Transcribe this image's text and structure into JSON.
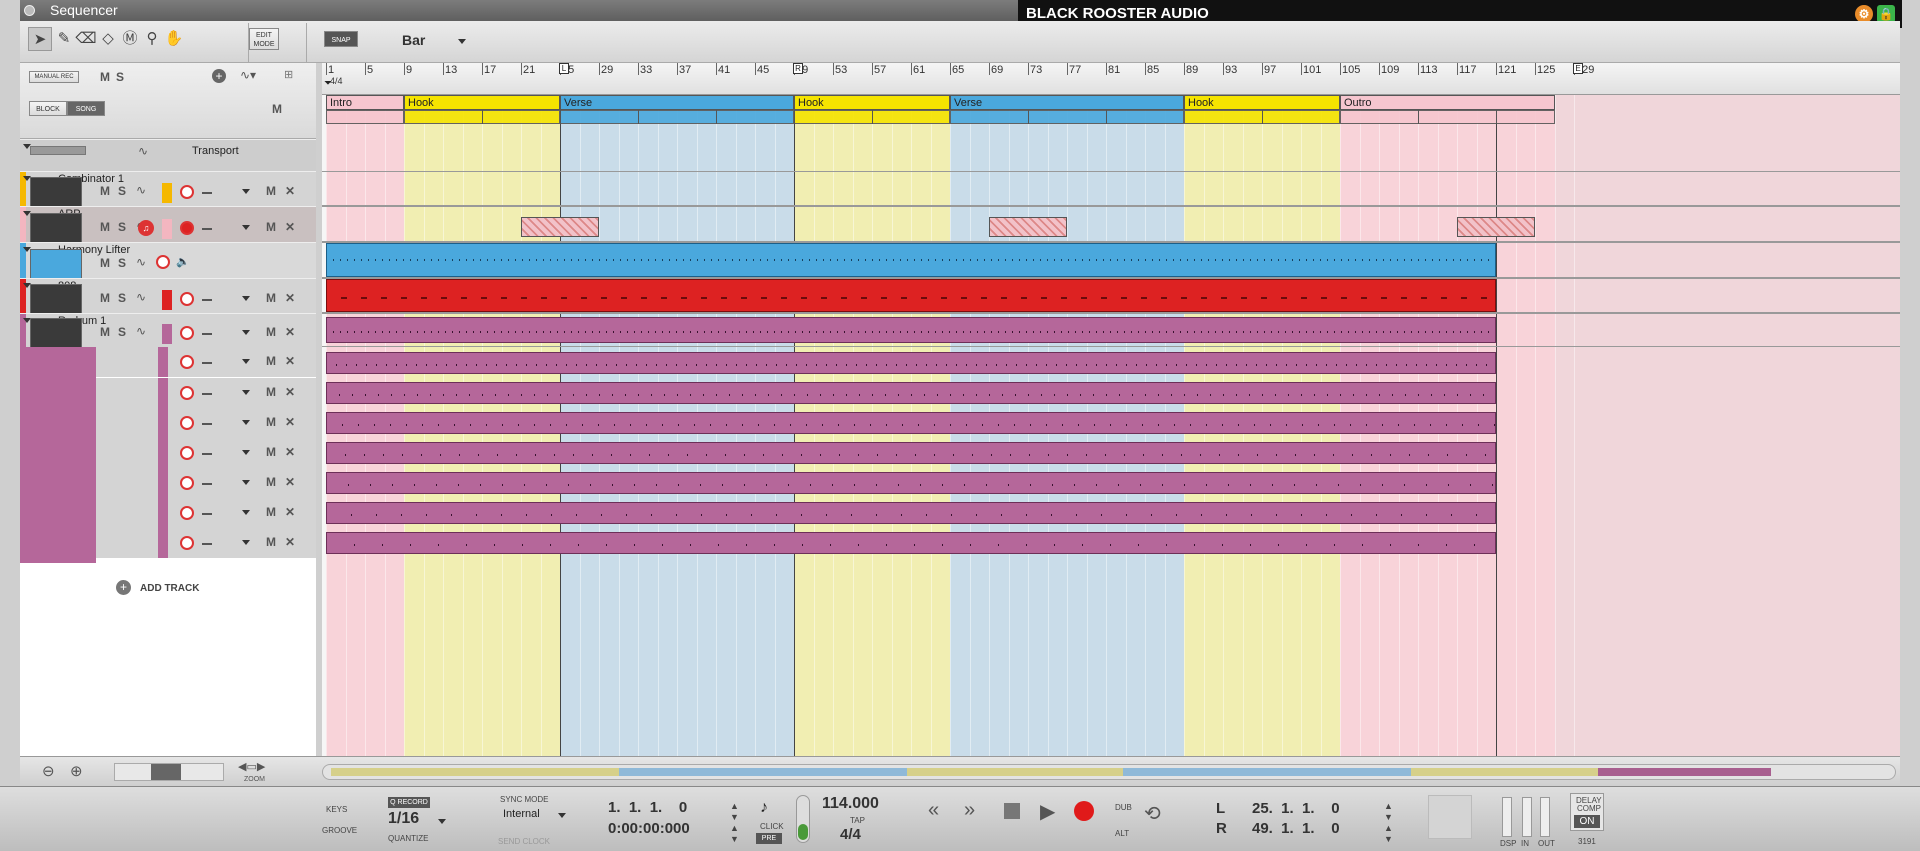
{
  "window": {
    "title": "Sequencer",
    "brand": "BLACK ROOSTER AUDIO"
  },
  "toolbar": {
    "edit_mode": [
      "EDIT",
      "MODE"
    ],
    "snap": "SNAP",
    "snap_value": "Bar"
  },
  "left_panel": {
    "manual_rec": "MANUAL REC",
    "m": "M",
    "s": "S",
    "block": "BLOCK",
    "song": "SONG",
    "transport_track": "Transport",
    "add_track": "ADD TRACK",
    "tracks": [
      {
        "name": "Combinator 1",
        "color": "#f5b800"
      },
      {
        "name": "ARP",
        "color": "#f3b6c0"
      },
      {
        "name": "Harmony Lifter",
        "color": "#4aa8dd"
      },
      {
        "name": "808",
        "color": "#dd2222"
      },
      {
        "name": "Redrum 1",
        "color": "#b5679a"
      }
    ],
    "lane_labels": {
      "m": "M",
      "s": "S",
      "x": "✕"
    }
  },
  "ruler": {
    "bars": [
      "1",
      "5",
      "9",
      "13",
      "17",
      "21",
      "25",
      "29",
      "33",
      "37",
      "41",
      "45",
      "49",
      "53",
      "57",
      "61",
      "65",
      "69",
      "73",
      "77",
      "81",
      "85",
      "89",
      "93",
      "97",
      "101",
      "105",
      "109",
      "113",
      "117",
      "121",
      "125",
      "129"
    ],
    "time_sig": "4/4",
    "markers": {
      "loop_left": "L",
      "loop_right": "R",
      "end": "E"
    }
  },
  "blocks": [
    {
      "label": "Intro",
      "start": 1,
      "end": 9,
      "color": "#f6c6cf"
    },
    {
      "label": "Hook",
      "start": 9,
      "end": 25,
      "color": "#f5e400"
    },
    {
      "label": "Verse",
      "start": 25,
      "end": 49,
      "color": "#4aa8dd"
    },
    {
      "label": "Hook",
      "start": 49,
      "end": 65,
      "color": "#f5e400"
    },
    {
      "label": "Verse",
      "start": 65,
      "end": 89,
      "color": "#4aa8dd"
    },
    {
      "label": "Hook",
      "start": 89,
      "end": 105,
      "color": "#f5e400"
    },
    {
      "label": "Outro",
      "start": 105,
      "end": 127,
      "color": "#f6c6cf"
    }
  ],
  "zoom_label": "ZOOM",
  "transport": {
    "keys": "KEYS",
    "groove": "GROOVE",
    "q_record": "Q RECORD",
    "quantize_value": "1/16",
    "quantize": "QUANTIZE",
    "sync_mode": "SYNC MODE",
    "sync_value": "Internal",
    "send_clock": "SEND CLOCK",
    "position": "1.  1.  1.    0",
    "time": "0:00:00:000",
    "click": "CLICK",
    "pre": "PRE",
    "tempo": "114.000",
    "tap": "TAP",
    "signature": "4/4",
    "dub": "DUB",
    "alt": "ALT",
    "left_loc": "25.  1.  1.    0",
    "right_loc": "49.  1.  1.    0",
    "l": "L",
    "r": "R",
    "dsp": "DSP",
    "in": "IN",
    "out": "OUT",
    "delay_comp": [
      "DELAY",
      "COMP"
    ],
    "on": "ON",
    "delay_value": "3191"
  }
}
